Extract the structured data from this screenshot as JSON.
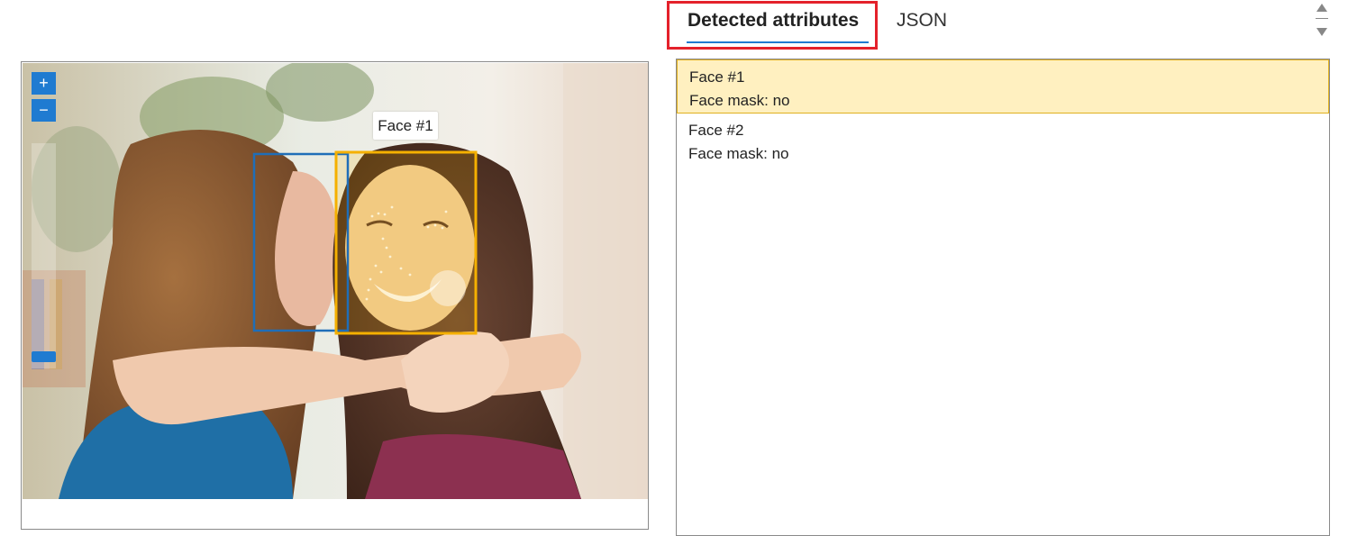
{
  "tabs": {
    "active_label": "Detected attributes",
    "json_label": "JSON"
  },
  "image_viewer": {
    "zoom_in_label": "+",
    "zoom_out_label": "−",
    "face_tooltip": "Face #1",
    "box_colors": {
      "face1": "#f5b000",
      "face2": "#1f6eb8"
    }
  },
  "faces": [
    {
      "title": "Face #1",
      "mask": "Face mask: no",
      "selected": true
    },
    {
      "title": "Face #2",
      "mask": "Face mask: no",
      "selected": false
    }
  ],
  "colors": {
    "accent": "#1f7bd1",
    "highlight": "#e4212b",
    "selected_bg": "#fff0c0"
  }
}
